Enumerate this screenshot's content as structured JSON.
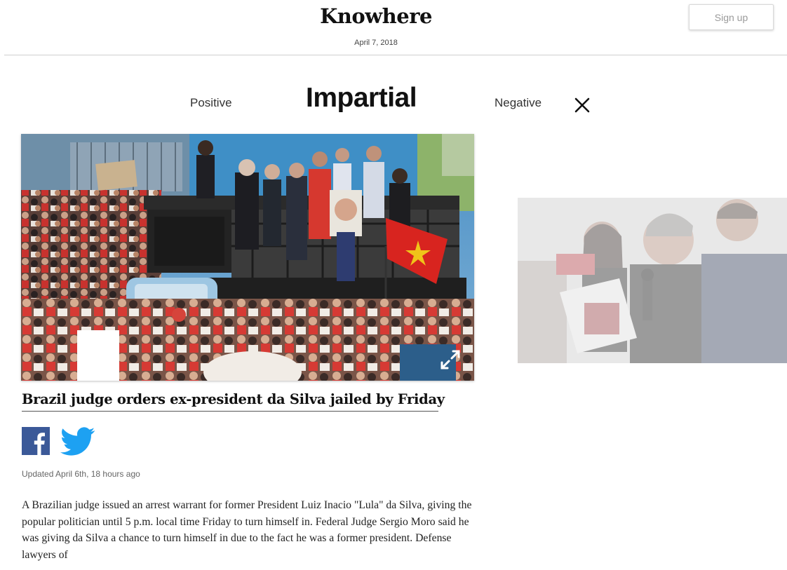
{
  "header": {
    "site_title": "Knowhere",
    "date": "April 7, 2018",
    "signup_label": "Sign up"
  },
  "tabs": {
    "positive": "Positive",
    "impartial": "Impartial",
    "negative": "Negative"
  },
  "article": {
    "headline": "Brazil judge orders ex-president da Silva jailed by Friday",
    "updated": "Updated April 6th, 18 hours ago",
    "body": "A Brazilian judge issued an arrest warrant for former President Luiz Inacio \"Lula\" da Silva, giving the popular politician until 5 p.m. local time Friday to turn himself in. Federal Judge Sergio Moro said he was giving da Silva a chance to turn himself in due to the fact he was a former president. Defense lawyers of"
  },
  "icons": {
    "close": "close-icon",
    "expand": "expand-icon",
    "facebook": "facebook-icon",
    "twitter": "twitter-icon"
  },
  "colors": {
    "facebook": "#3b5998",
    "twitter": "#1da1f2",
    "flag_red": "#d8241f"
  }
}
